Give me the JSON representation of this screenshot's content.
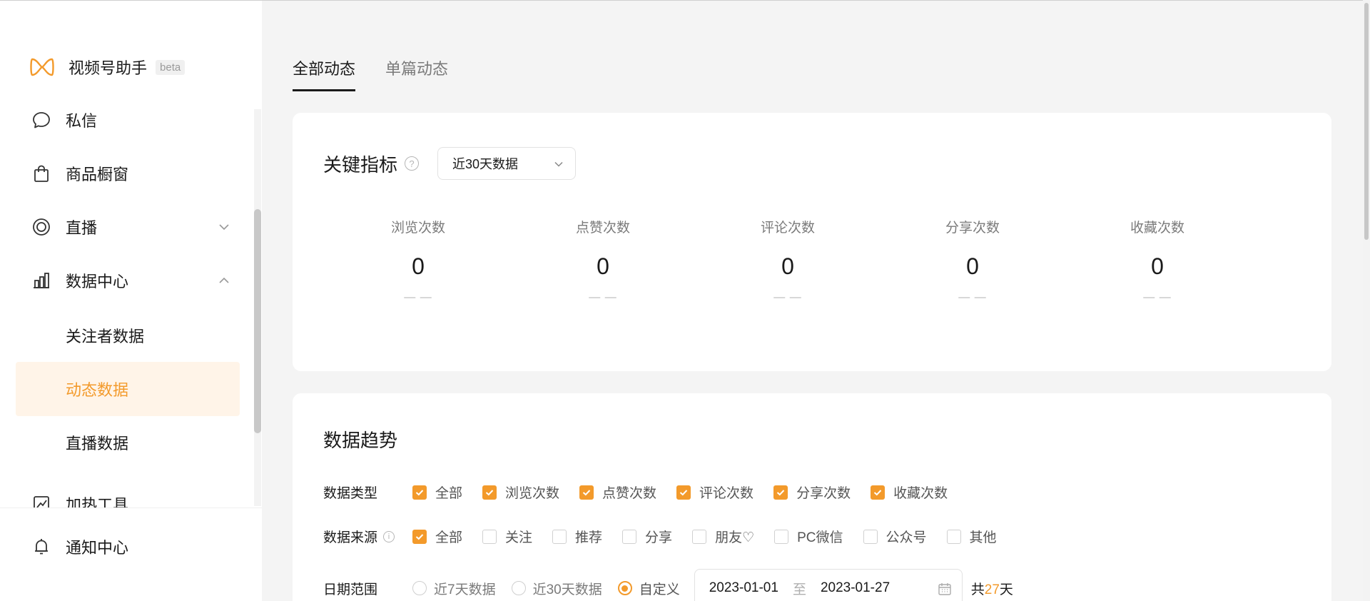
{
  "brand": {
    "name": "视频号助手",
    "badge": "beta",
    "accent": "#f39a2b"
  },
  "sidebar": {
    "items": [
      {
        "label": "私信",
        "icon": "message-icon"
      },
      {
        "label": "商品橱窗",
        "icon": "shopping-bag-icon"
      },
      {
        "label": "直播",
        "icon": "live-icon",
        "expandable": true,
        "expanded": false
      },
      {
        "label": "数据中心",
        "icon": "chart-icon",
        "expandable": true,
        "expanded": true
      },
      {
        "label": "加热工具",
        "icon": "trend-icon"
      }
    ],
    "sub_items": [
      {
        "label": "关注者数据",
        "active": false
      },
      {
        "label": "动态数据",
        "active": true
      },
      {
        "label": "直播数据",
        "active": false
      }
    ],
    "bottom": {
      "label": "通知中心",
      "icon": "bell-icon"
    }
  },
  "tabs": [
    {
      "label": "全部动态",
      "active": true
    },
    {
      "label": "单篇动态",
      "active": false
    }
  ],
  "kpi": {
    "title": "关键指标",
    "period_select": "近30天数据",
    "metrics": [
      {
        "label": "浏览次数",
        "value": "0",
        "trend": "— —"
      },
      {
        "label": "点赞次数",
        "value": "0",
        "trend": "— —"
      },
      {
        "label": "评论次数",
        "value": "0",
        "trend": "— —"
      },
      {
        "label": "分享次数",
        "value": "0",
        "trend": "— —"
      },
      {
        "label": "收藏次数",
        "value": "0",
        "trend": "— —"
      }
    ]
  },
  "trend": {
    "title": "数据趋势",
    "data_type": {
      "label": "数据类型",
      "options": [
        {
          "label": "全部",
          "checked": true
        },
        {
          "label": "浏览次数",
          "checked": true
        },
        {
          "label": "点赞次数",
          "checked": true
        },
        {
          "label": "评论次数",
          "checked": true
        },
        {
          "label": "分享次数",
          "checked": true
        },
        {
          "label": "收藏次数",
          "checked": true
        }
      ]
    },
    "data_source": {
      "label": "数据来源",
      "options": [
        {
          "label": "全部",
          "checked": true
        },
        {
          "label": "关注",
          "checked": false
        },
        {
          "label": "推荐",
          "checked": false
        },
        {
          "label": "分享",
          "checked": false
        },
        {
          "label": "朋友♡",
          "checked": false
        },
        {
          "label": "PC微信",
          "checked": false
        },
        {
          "label": "公众号",
          "checked": false
        },
        {
          "label": "其他",
          "checked": false
        }
      ]
    },
    "date_range": {
      "label": "日期范围",
      "options": [
        {
          "label": "近7天数据",
          "checked": false
        },
        {
          "label": "近30天数据",
          "checked": false
        },
        {
          "label": "自定义",
          "checked": true
        }
      ],
      "start": "2023-01-01",
      "separator": "至",
      "end": "2023-01-27",
      "total_prefix": "共",
      "total_days": "27",
      "total_suffix": "天"
    }
  }
}
